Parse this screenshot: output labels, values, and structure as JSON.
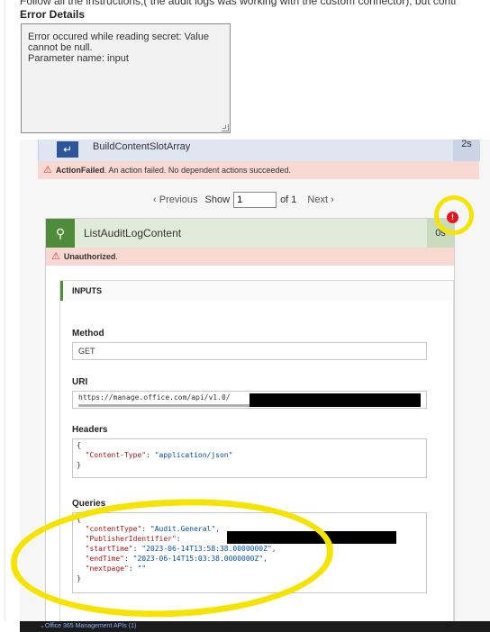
{
  "top_text": "Follow all the instructions,( the audit logs was working with the custom connector), but conti",
  "error_details": {
    "title": "Error Details",
    "message": "Error occured while reading secret: Value cannot be null.\nParameter name: input"
  },
  "prev_action": {
    "name": "BuildContentSlotArray",
    "duration": "2s"
  },
  "action_failed": {
    "strong": "ActionFailed",
    "text": ". An action failed. No dependent actions succeeded."
  },
  "pager": {
    "previous": "Previous",
    "show": "Show",
    "page_value": "1",
    "of": "of 1",
    "next": "Next"
  },
  "error_badge": "!",
  "card": {
    "title": "ListAuditLogContent",
    "duration": "0s",
    "status_strong": "Unauthorized",
    "status_suffix": "."
  },
  "inputs": {
    "header": "INPUTS",
    "method_label": "Method",
    "method_value": "GET",
    "uri_label": "URI",
    "uri_value": "https://manage.office.com/api/v1.0/",
    "headers_label": "Headers",
    "queries_label": "Queries"
  },
  "headers_json": [
    {
      "key": "\"Content-Type\"",
      "value": "\"application/json\""
    }
  ],
  "queries_json": [
    {
      "key": "\"contentType\"",
      "value": "\"Audit.General\","
    },
    {
      "key": "\"PublisherIdentifier\"",
      "value": ""
    },
    {
      "key": "\"startTime\"",
      "value": "\"2023-06-14T13:58:38.0000000Z\","
    },
    {
      "key": "\"endTime\"",
      "value": "\"2023-06-14T15:03:38.0000000Z\","
    },
    {
      "key": "\"nextpage\"",
      "value": "\"\""
    }
  ],
  "bottom_bar": "Office 365 Management APIs (1)",
  "icons": [
    "up-arrow-icon",
    "warning-icon",
    "chevron-left-icon",
    "chevron-right-icon",
    "globe-icon",
    "error-icon",
    "chevron-down-icon"
  ],
  "colors": {
    "error_red": "#e81123",
    "success_green": "#4f8c3a",
    "highlight_yellow": "#f6e400",
    "banner_red": "#f7d9d1"
  }
}
